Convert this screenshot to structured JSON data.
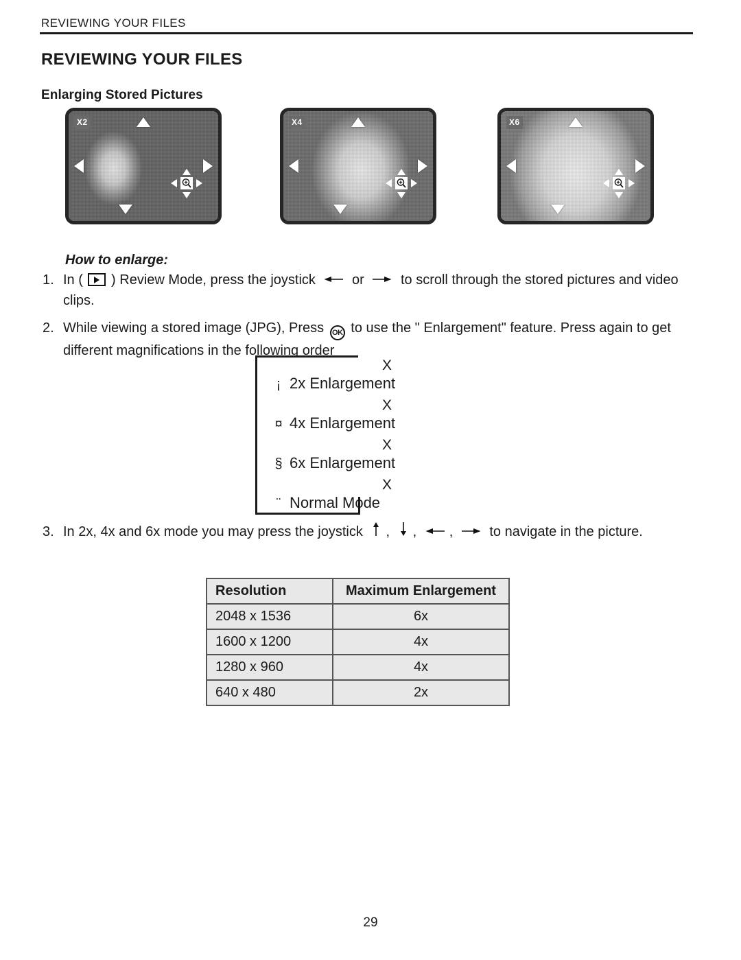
{
  "header": {
    "running_head": "REVIEWING YOUR FILES",
    "page_title": "REVIEWING YOUR FILES",
    "section_title": "Enlarging Stored Pictures"
  },
  "panels": [
    {
      "badge": "X2",
      "alt": "camera-lcd-preview-2x"
    },
    {
      "badge": "X4",
      "alt": "camera-lcd-preview-4x"
    },
    {
      "badge": "X6",
      "alt": "camera-lcd-preview-6x"
    }
  ],
  "how_to": {
    "heading": "How to enlarge:",
    "steps": [
      {
        "number": "1.",
        "text_before_icon": "In (",
        "icon": "playback-mode-icon",
        "text_after_icon": ") Review Mode, press the joystick",
        "arrow_left": "left-arrow-icon",
        "conjunction": "or",
        "arrow_right": "right-arrow-icon",
        "text_end": "to scroll through the stored pictures and video clips."
      },
      {
        "number": "2.",
        "text_before_icon": "While viewing a stored image (JPG), Press",
        "icon": "ok-button-icon",
        "icon_label": "OK",
        "text_after_icon": "to use the \" Enlargement\" feature. Press again to get different magnifications in the following order"
      },
      {
        "number": "3.",
        "text_before_icon": "In 2x, 4x and 6x mode you may press the joystick",
        "arrows": [
          "up-arrow-icon",
          "down-arrow-icon",
          "left-arrow-icon",
          "right-arrow-icon"
        ],
        "text_end": "to navigate in the picture."
      }
    ]
  },
  "flow": {
    "separator": "X",
    "items": [
      {
        "bullet": "¡",
        "label": "2x Enlargement"
      },
      {
        "bullet": "¤",
        "label": "4x Enlargement"
      },
      {
        "bullet": "§",
        "label": "6x Enlargement"
      },
      {
        "bullet": "¨",
        "label": "Normal Mode"
      }
    ]
  },
  "table": {
    "headers": [
      "Resolution",
      "Maximum Enlargement"
    ],
    "rows": [
      [
        "2048 x 1536",
        "6x"
      ],
      [
        "1600 x 1200",
        "4x"
      ],
      [
        "1280 x 960",
        "4x"
      ],
      [
        "640 x 480",
        "2x"
      ]
    ]
  },
  "footer": {
    "page_number": "29"
  },
  "colors": {
    "text": "#1a1a1a",
    "rule": "#1a1a1a",
    "table_fill": "#e8e8e8",
    "table_border": "#555555",
    "badge_fill": "#6a6a6a"
  }
}
